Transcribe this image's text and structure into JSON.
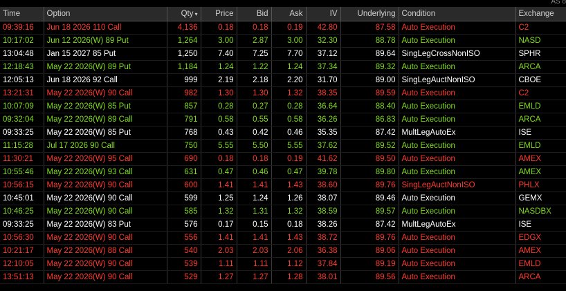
{
  "corner_text": "AS o",
  "columns": {
    "time": "Time",
    "option": "Option",
    "qty": "Qty",
    "price": "Price",
    "bid": "Bid",
    "ask": "Ask",
    "iv": "IV",
    "underlying": "Underlying",
    "condition": "Condition",
    "exchange": "Exchange"
  },
  "sort_icon": "▾",
  "colors": {
    "red": "#ff3b2f",
    "green": "#7fdc1c",
    "white": "#ffffff"
  },
  "rows": [
    {
      "color": "red",
      "time": "09:39:16",
      "option": "Jun 18 2026 110 Call",
      "qty": "4,136",
      "price": "0.18",
      "bid": "0.18",
      "ask": "0.19",
      "iv": "42.80",
      "underlying": "87.58",
      "condition": "Auto Execution",
      "exchange": "C2"
    },
    {
      "color": "green",
      "time": "10:17:02",
      "option": "Jun 12 2026(W) 89 Put",
      "qty": "1,264",
      "price": "3.00",
      "bid": "2.87",
      "ask": "3.00",
      "iv": "32.30",
      "underlying": "88.78",
      "condition": "Auto Execution",
      "exchange": "NASD"
    },
    {
      "color": "white",
      "time": "13:04:48",
      "option": "Jan 15 2027 85 Put",
      "qty": "1,250",
      "price": "7.40",
      "bid": "7.25",
      "ask": "7.70",
      "iv": "37.12",
      "underlying": "89.64",
      "condition": "SingLegCrossNonISO",
      "exchange": "SPHR"
    },
    {
      "color": "green",
      "time": "12:18:43",
      "option": "May 22 2026(W) 89 Put",
      "qty": "1,184",
      "price": "1.24",
      "bid": "1.22",
      "ask": "1.24",
      "iv": "37.34",
      "underlying": "89.32",
      "condition": "Auto Execution",
      "exchange": "ARCA"
    },
    {
      "color": "white",
      "time": "12:05:13",
      "option": "Jun 18 2026 92 Call",
      "qty": "999",
      "price": "2.19",
      "bid": "2.18",
      "ask": "2.20",
      "iv": "31.70",
      "underlying": "89.00",
      "condition": "SingLegAuctNonISO",
      "exchange": "CBOE"
    },
    {
      "color": "red",
      "time": "13:21:31",
      "option": "May 22 2026(W) 90 Call",
      "qty": "982",
      "price": "1.30",
      "bid": "1.30",
      "ask": "1.32",
      "iv": "38.35",
      "underlying": "89.59",
      "condition": "Auto Execution",
      "exchange": "C2"
    },
    {
      "color": "green",
      "time": "10:07:09",
      "option": "May 22 2026(W) 85 Put",
      "qty": "857",
      "price": "0.28",
      "bid": "0.27",
      "ask": "0.28",
      "iv": "36.64",
      "underlying": "88.40",
      "condition": "Auto Execution",
      "exchange": "EMLD"
    },
    {
      "color": "green",
      "time": "09:32:04",
      "option": "May 22 2026(W) 89 Call",
      "qty": "791",
      "price": "0.58",
      "bid": "0.55",
      "ask": "0.58",
      "iv": "36.26",
      "underlying": "86.83",
      "condition": "Auto Execution",
      "exchange": "ARCA"
    },
    {
      "color": "white",
      "time": "09:33:25",
      "option": "May 22 2026(W) 85 Put",
      "qty": "768",
      "price": "0.43",
      "bid": "0.42",
      "ask": "0.46",
      "iv": "35.35",
      "underlying": "87.42",
      "condition": "MultLegAutoEx",
      "exchange": "ISE"
    },
    {
      "color": "green",
      "time": "11:15:28",
      "option": "Jul 17 2026 90 Call",
      "qty": "750",
      "price": "5.55",
      "bid": "5.50",
      "ask": "5.55",
      "iv": "37.62",
      "underlying": "89.52",
      "condition": "Auto Execution",
      "exchange": "EMLD"
    },
    {
      "color": "red",
      "time": "11:30:21",
      "option": "May 22 2026(W) 95 Call",
      "qty": "690",
      "price": "0.18",
      "bid": "0.18",
      "ask": "0.19",
      "iv": "41.62",
      "underlying": "89.50",
      "condition": "Auto Execution",
      "exchange": "AMEX"
    },
    {
      "color": "green",
      "time": "10:55:46",
      "option": "May 22 2026(W) 93 Call",
      "qty": "631",
      "price": "0.47",
      "bid": "0.46",
      "ask": "0.47",
      "iv": "39.78",
      "underlying": "89.80",
      "condition": "Auto Execution",
      "exchange": "AMEX"
    },
    {
      "color": "red",
      "time": "10:56:15",
      "option": "May 22 2026(W) 90 Call",
      "qty": "600",
      "price": "1.41",
      "bid": "1.41",
      "ask": "1.43",
      "iv": "38.60",
      "underlying": "89.76",
      "condition": "SingLegAuctNonISO",
      "exchange": "PHLX"
    },
    {
      "color": "white",
      "time": "10:45:01",
      "option": "May 22 2026(W) 90 Call",
      "qty": "599",
      "price": "1.25",
      "bid": "1.24",
      "ask": "1.26",
      "iv": "38.07",
      "underlying": "89.46",
      "condition": "Auto Execution",
      "exchange": "GEMX"
    },
    {
      "color": "green",
      "time": "10:46:25",
      "option": "May 22 2026(W) 90 Call",
      "qty": "585",
      "price": "1.32",
      "bid": "1.31",
      "ask": "1.32",
      "iv": "38.59",
      "underlying": "89.57",
      "condition": "Auto Execution",
      "exchange": "NASDBX"
    },
    {
      "color": "white",
      "time": "09:33:25",
      "option": "May 22 2026(W) 83 Put",
      "qty": "576",
      "price": "0.17",
      "bid": "0.15",
      "ask": "0.18",
      "iv": "38.26",
      "underlying": "87.42",
      "condition": "MultLegAutoEx",
      "exchange": "ISE"
    },
    {
      "color": "red",
      "time": "10:56:30",
      "option": "May 22 2026(W) 90 Call",
      "qty": "556",
      "price": "1.41",
      "bid": "1.41",
      "ask": "1.43",
      "iv": "38.72",
      "underlying": "89.76",
      "condition": "Auto Execution",
      "exchange": "EDGX"
    },
    {
      "color": "red",
      "time": "10:21:17",
      "option": "May 22 2026(W) 88 Call",
      "qty": "540",
      "price": "2.03",
      "bid": "2.03",
      "ask": "2.06",
      "iv": "36.38",
      "underlying": "89.06",
      "condition": "Auto Execution",
      "exchange": "AMEX"
    },
    {
      "color": "red",
      "time": "12:10:05",
      "option": "May 22 2026(W) 90 Call",
      "qty": "539",
      "price": "1.11",
      "bid": "1.11",
      "ask": "1.12",
      "iv": "37.84",
      "underlying": "89.19",
      "condition": "Auto Execution",
      "exchange": "EMLD"
    },
    {
      "color": "red",
      "time": "13:51:13",
      "option": "May 22 2026(W) 90 Call",
      "qty": "529",
      "price": "1.27",
      "bid": "1.27",
      "ask": "1.28",
      "iv": "38.01",
      "underlying": "89.56",
      "condition": "Auto Execution",
      "exchange": "ARCA"
    }
  ]
}
